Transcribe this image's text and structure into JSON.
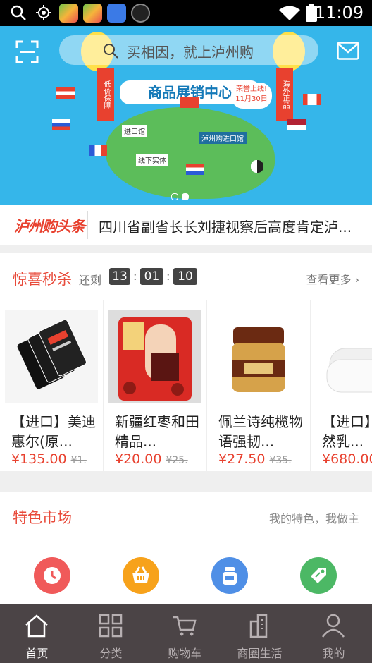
{
  "status_bar": {
    "time": "11:09"
  },
  "banner": {
    "search_placeholder": "买相因，就上泸州购",
    "hero_title": "商品展销中心",
    "ribbon_left": "低价保障",
    "ribbon_right": "海外正品",
    "launch_tag": "荣誉上线!",
    "launch_date": "11月30日",
    "hall_label": "泸州购进口馆",
    "import_label": "进口馆",
    "offline_label": "线下实体"
  },
  "news": {
    "logo": "泸州购头条",
    "headline": "四川省副省长长刘捷视察后高度肯定泸..."
  },
  "flash_sale": {
    "title": "惊喜秒杀",
    "remain_label": "还剩",
    "hours": "13",
    "minutes": "01",
    "seconds": "10",
    "more_label": "查看更多",
    "products": [
      {
        "name": "【进口】美迪惠尔(原...",
        "price": "¥135.00",
        "old_price": "¥1."
      },
      {
        "name": "新疆红枣和田精品...",
        "price": "¥20.00",
        "old_price": "¥25."
      },
      {
        "name": "佩兰诗纯榄物语强韧...",
        "price": "¥27.50",
        "old_price": "¥35."
      },
      {
        "name": "【进口】口天然乳...",
        "price": "¥680.00",
        "old_price": ""
      }
    ]
  },
  "market": {
    "title": "特色市场",
    "slogan": "我的特色，我做主",
    "icons": [
      "clock-icon",
      "basket-icon",
      "jar-icon",
      "tag-icon"
    ],
    "icon_colors": [
      "#f05a5a",
      "#f7a21b",
      "#4f8fe6",
      "#4cb865"
    ]
  },
  "tabs": [
    {
      "label": "首页",
      "icon": "home-icon",
      "active": true
    },
    {
      "label": "分类",
      "icon": "grid-icon",
      "active": false
    },
    {
      "label": "购物车",
      "icon": "cart-icon",
      "active": false
    },
    {
      "label": "商圈生活",
      "icon": "city-icon",
      "active": false
    },
    {
      "label": "我的",
      "icon": "user-icon",
      "active": false
    }
  ],
  "colors": {
    "accent": "#e84a3a",
    "banner_bg": "#35b6ea",
    "tabbar_bg": "#4b4446"
  }
}
